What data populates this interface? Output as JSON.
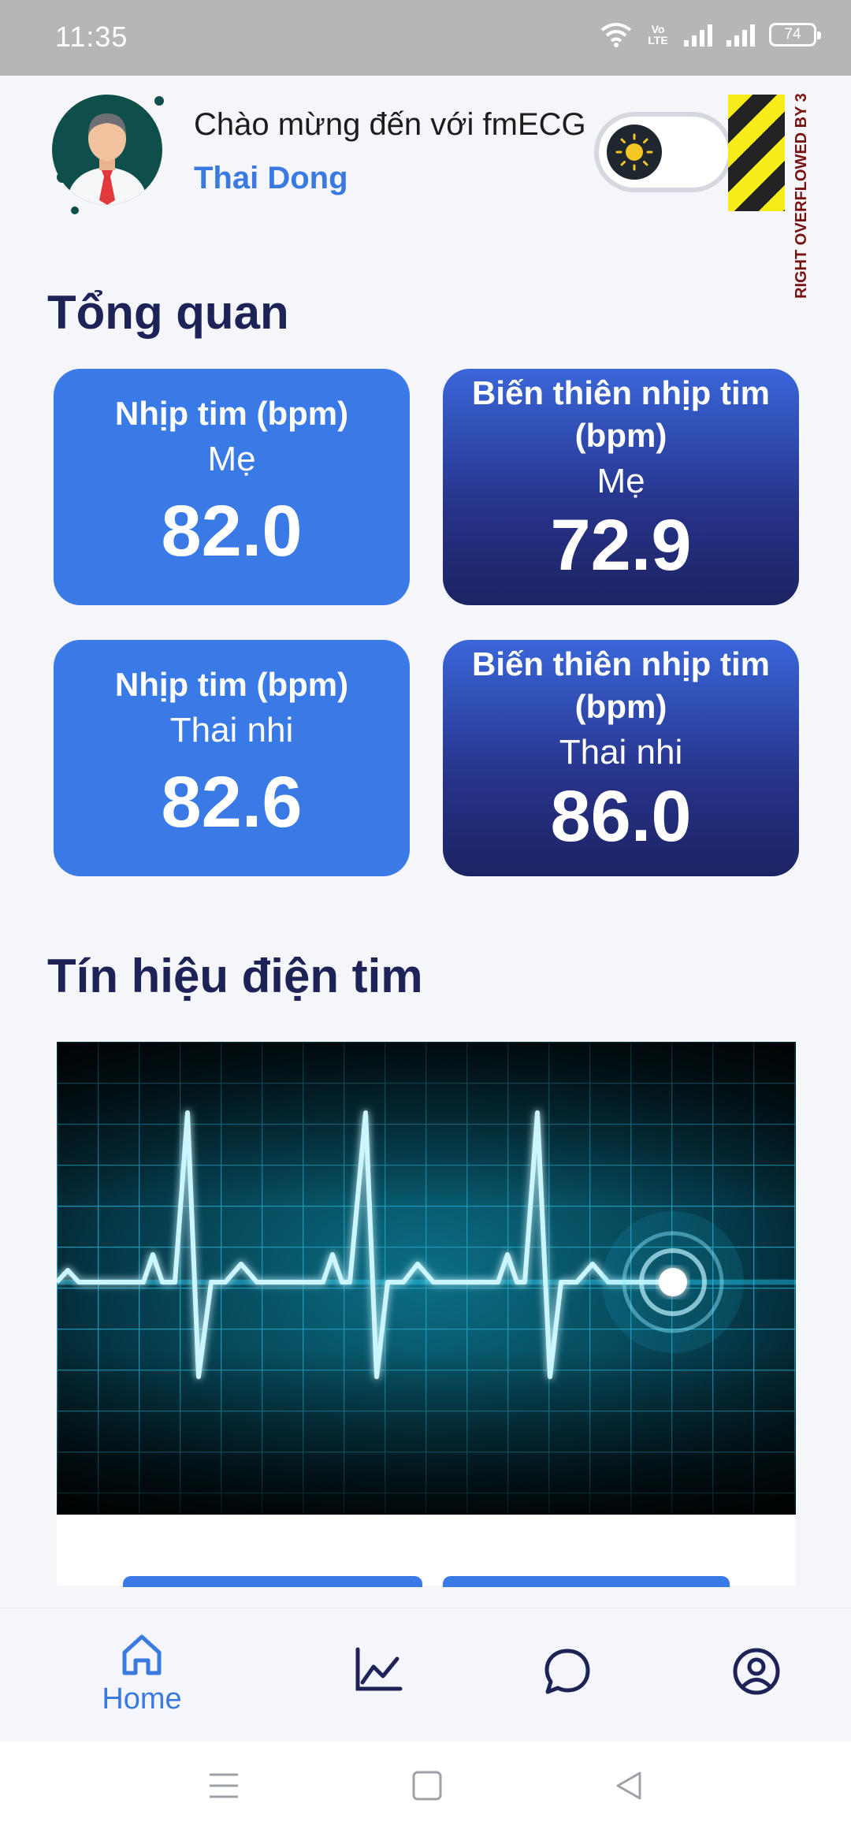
{
  "status_bar": {
    "time": "11:35",
    "network_label": "Vo LTE",
    "battery": "74"
  },
  "header": {
    "welcome": "Chào mừng đến với fmECG",
    "username": "Thai Dong",
    "theme_toggle_icon": "sun-icon",
    "overflow_warning": "RIGHT OVERFLOWED BY 3"
  },
  "overview": {
    "title": "Tổng quan",
    "cards": [
      {
        "label": "Nhịp tim (bpm)",
        "subject": "Mẹ",
        "value": "82.0"
      },
      {
        "label": "Biến thiên nhịp tim (bpm)",
        "subject": "Mẹ",
        "value": "72.9"
      },
      {
        "label": "Nhịp tim (bpm)",
        "subject": "Thai nhi",
        "value": "82.6"
      },
      {
        "label": "Biến thiên nhịp tim (bpm)",
        "subject": "Thai nhi",
        "value": "86.0"
      }
    ]
  },
  "ecg": {
    "title": "Tín hiệu điện tim"
  },
  "bottom_nav": {
    "items": [
      {
        "label": "Home",
        "icon": "home-icon",
        "active": true
      },
      {
        "label": "",
        "icon": "chart-icon",
        "active": false
      },
      {
        "label": "",
        "icon": "chat-icon",
        "active": false
      },
      {
        "label": "",
        "icon": "profile-icon",
        "active": false
      }
    ]
  },
  "colors": {
    "accent": "#3a7ae6",
    "heading": "#1d2356",
    "card_dark": "#1d2362"
  }
}
